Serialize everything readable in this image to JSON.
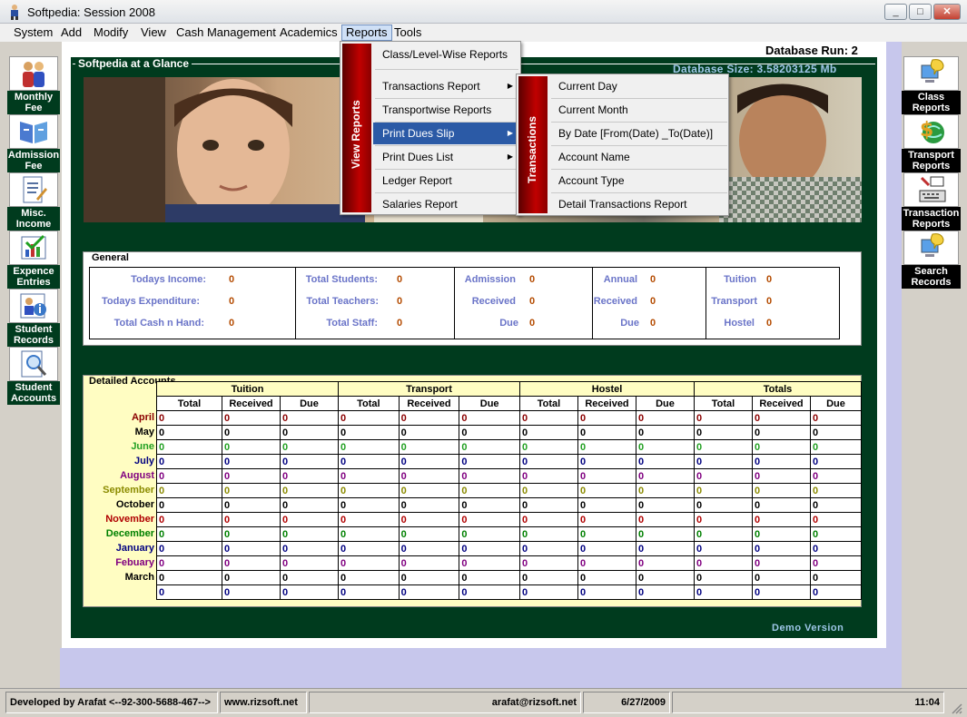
{
  "window": {
    "title": "Softpedia: Session 2008"
  },
  "menubar": [
    "System",
    "Add",
    "Modify",
    "View",
    "Cash Management",
    "Academics",
    "Reports",
    "Tools"
  ],
  "left_sidebar": [
    {
      "label": "Monthly Fee",
      "icon": "people-icon"
    },
    {
      "label": "Admission Fee",
      "icon": "book-icon"
    },
    {
      "label": "Misc. Income",
      "icon": "document-icon"
    },
    {
      "label": "Expence Entries",
      "icon": "chart-check-icon"
    },
    {
      "label": "Student Records",
      "icon": "student-info-icon"
    },
    {
      "label": "Student Accounts",
      "icon": "magnifier-icon"
    }
  ],
  "right_sidebar": [
    {
      "label": "Class Reports",
      "icon": "computer-icon"
    },
    {
      "label": "Transport Reports",
      "icon": "dollar-globe-icon"
    },
    {
      "label": "Transaction Reports",
      "icon": "keyboard-icon"
    },
    {
      "label": "Search Records",
      "icon": "computer-search-icon"
    }
  ],
  "main": {
    "db_run": "Database Run: 2",
    "glance_title": "Softpedia at a Glance",
    "db_size": "Database Size: 3.58203125  Mb",
    "demo": "Demo Version"
  },
  "general": {
    "title": "General",
    "groups": [
      [
        {
          "label": "Todays Income:",
          "value": "0"
        },
        {
          "label": "Todays Expenditure:",
          "value": "0"
        },
        {
          "label": "Total Cash n Hand:",
          "value": "0"
        }
      ],
      [
        {
          "label": "Total Students:",
          "value": "0"
        },
        {
          "label": "Total Teachers:",
          "value": "0"
        },
        {
          "label": "Total Staff:",
          "value": "0"
        }
      ],
      [
        {
          "label": "Admission",
          "value": "0"
        },
        {
          "label": "Received",
          "value": "0"
        },
        {
          "label": "Due",
          "value": "0"
        }
      ],
      [
        {
          "label": "Annual",
          "value": "0"
        },
        {
          "label": "Received",
          "value": "0"
        },
        {
          "label": "Due",
          "value": "0"
        }
      ],
      [
        {
          "label": "Tuition",
          "value": "0"
        },
        {
          "label": "Transport",
          "value": "0"
        },
        {
          "label": "Hostel",
          "value": "0"
        }
      ]
    ]
  },
  "detailed": {
    "title": "Detailed Accounts",
    "groups": [
      "Tuition",
      "Transport",
      "Hostel",
      "Totals"
    ],
    "subheaders": [
      "Total",
      "Received",
      "Due"
    ],
    "months": [
      {
        "name": "April",
        "color": "#8b0000"
      },
      {
        "name": "May",
        "color": "#000000"
      },
      {
        "name": "June",
        "color": "#22a022"
      },
      {
        "name": "July",
        "color": "#000080"
      },
      {
        "name": "August",
        "color": "#800080"
      },
      {
        "name": "September",
        "color": "#8b8b00"
      },
      {
        "name": "October",
        "color": "#000000"
      },
      {
        "name": "November",
        "color": "#b00000"
      },
      {
        "name": "December",
        "color": "#008000"
      },
      {
        "name": "January",
        "color": "#000080"
      },
      {
        "name": "Febuary",
        "color": "#800080"
      },
      {
        "name": "March",
        "color": "#000000"
      },
      {
        "name": "",
        "color": "#000080"
      }
    ],
    "cell_value": "0"
  },
  "reports_menu": {
    "sidebar_label": "View Reports",
    "items": [
      {
        "label": "Class/Level-Wise Reports",
        "submenu": false
      },
      {
        "label": "Transactions Report",
        "submenu": true
      },
      {
        "label": "Transportwise Reports",
        "submenu": false
      },
      {
        "label": "Print Dues Slip",
        "submenu": true
      },
      {
        "label": "Print Dues List",
        "submenu": true
      },
      {
        "label": "Ledger Report",
        "submenu": false
      },
      {
        "label": "Salaries Report",
        "submenu": false
      }
    ]
  },
  "transactions_menu": {
    "sidebar_label": "Transactions",
    "items": [
      "Current Day",
      "Current Month",
      "By Date [From(Date)  _To(Date)]",
      "Account Name",
      "Account Type",
      "Detail Transactions Report"
    ]
  },
  "statusbar": {
    "developer": "Developed by Arafat <--92-300-5688-467-->",
    "website": "www.rizsoft.net",
    "email": "arafat@rizsoft.net",
    "date": "6/27/2009",
    "time": "11:04"
  }
}
